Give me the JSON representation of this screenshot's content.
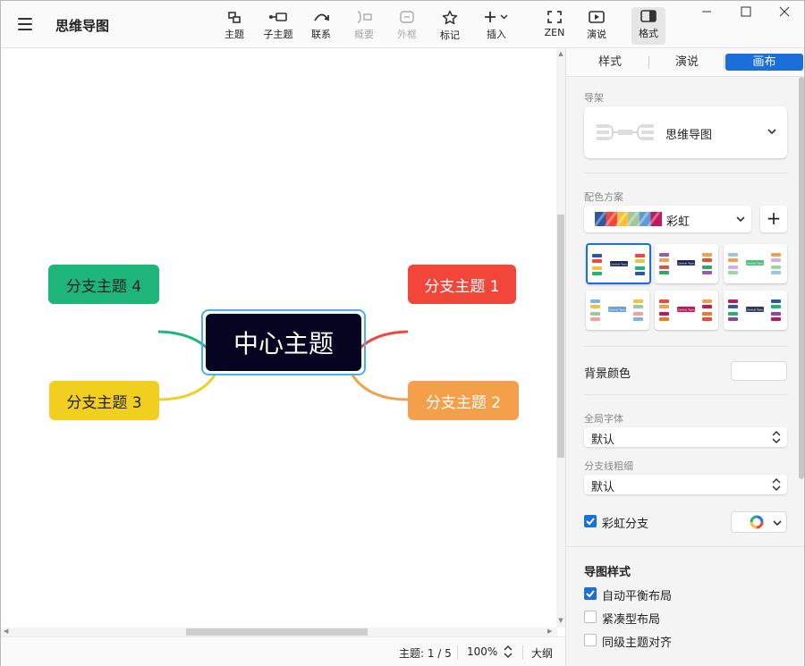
{
  "app": {
    "title": "思维导图"
  },
  "toolbar": {
    "items": [
      {
        "label": "主题"
      },
      {
        "label": "子主题"
      },
      {
        "label": "联系"
      },
      {
        "label": "概要"
      },
      {
        "label": "外框"
      },
      {
        "label": "标记"
      },
      {
        "label": "插入"
      },
      {
        "label": "ZEN"
      },
      {
        "label": "演说"
      },
      {
        "label": "格式"
      }
    ]
  },
  "mindmap": {
    "central": "中心主题",
    "branches": [
      {
        "label": "分支主题 1",
        "color": "#f2463b"
      },
      {
        "label": "分支主题 2",
        "color": "#f4a04a"
      },
      {
        "label": "分支主题 3",
        "color": "#f0cf1f"
      },
      {
        "label": "分支主题 4",
        "color": "#1eb57a"
      }
    ]
  },
  "statusbar": {
    "topics": "主题: 1 / 5",
    "zoom": "100%",
    "outline": "大纲"
  },
  "panel": {
    "tabs": [
      {
        "label": "样式"
      },
      {
        "label": "演说"
      },
      {
        "label": "画布"
      }
    ],
    "skeleton": {
      "label": "导架",
      "value": "思维导图"
    },
    "color_scheme": {
      "label": "配色方案",
      "value": "彩虹",
      "add": "+"
    },
    "theme_thumb_text": "Central Topic",
    "background": {
      "label": "背景颜色"
    },
    "font": {
      "label": "全局字体",
      "value": "默认"
    },
    "line_width": {
      "label": "分支线粗细",
      "value": "默认"
    },
    "rainbow_branch": {
      "label": "彩虹分支",
      "checked": true
    },
    "map_style": {
      "title": "导图样式",
      "options": [
        {
          "label": "自动平衡布局",
          "checked": true
        },
        {
          "label": "紧凑型布局",
          "checked": false
        },
        {
          "label": "同级主题对齐",
          "checked": false
        }
      ]
    }
  },
  "colors": {
    "accent": "#1a6fd8",
    "central_bg": "#050522",
    "selection": "#4ab2e8"
  }
}
